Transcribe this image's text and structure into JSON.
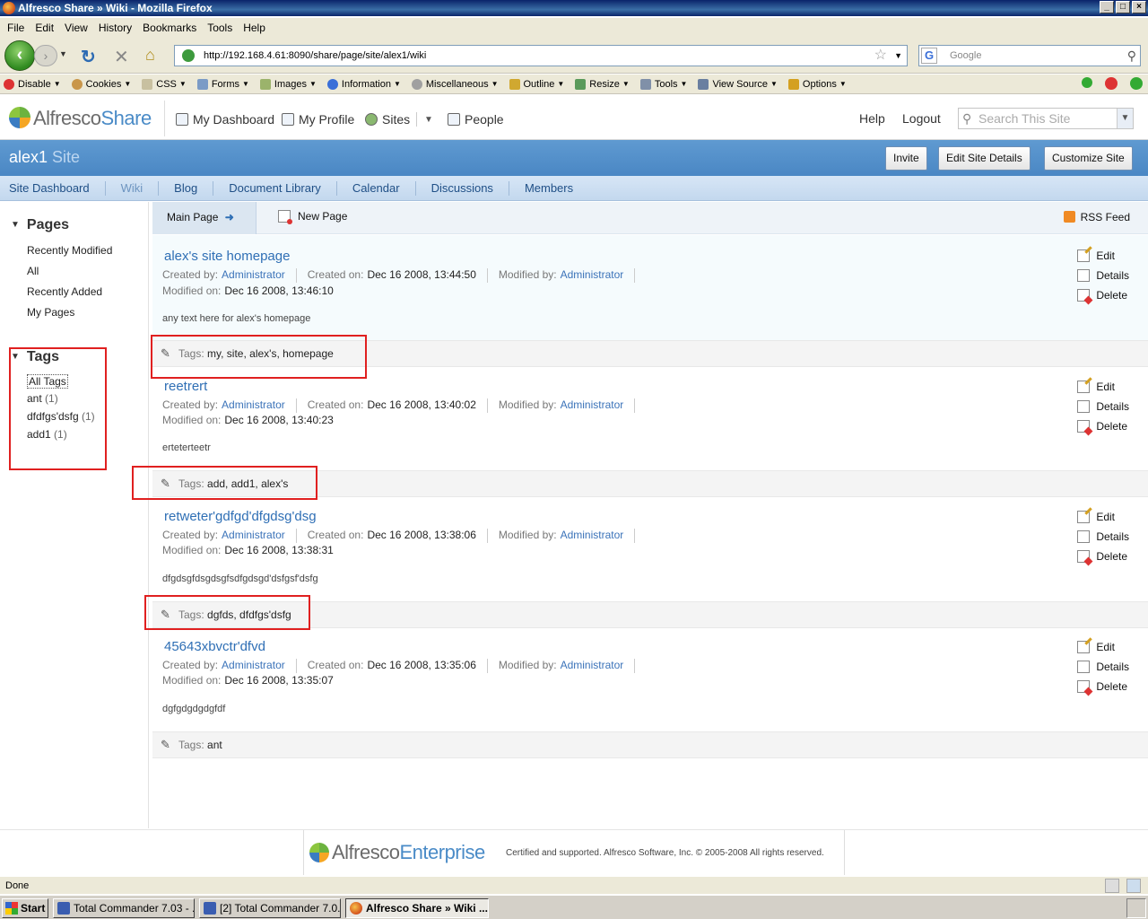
{
  "window": {
    "title": "Alfresco Share » Wiki - Mozilla Firefox"
  },
  "menubar": [
    "File",
    "Edit",
    "View",
    "History",
    "Bookmarks",
    "Tools",
    "Help"
  ],
  "browser": {
    "url": "http://192.168.4.61:8090/share/page/site/alex1/wiki",
    "search_placeholder": "Google"
  },
  "devtoolbar": [
    "Disable",
    "Cookies",
    "CSS",
    "Forms",
    "Images",
    "Information",
    "Miscellaneous",
    "Outline",
    "Resize",
    "Tools",
    "View Source",
    "Options"
  ],
  "header": {
    "logo_prefix": "Alfresco",
    "logo_suffix": "Share",
    "nav": [
      "My Dashboard",
      "My Profile",
      "Sites",
      "People"
    ],
    "help": "Help",
    "logout": "Logout",
    "search_placeholder": "Search This Site"
  },
  "site": {
    "name": "alex1",
    "label": "Site",
    "buttons": [
      "Invite",
      "Edit Site Details",
      "Customize Site"
    ],
    "nav": [
      "Site Dashboard",
      "Wiki",
      "Blog",
      "Document Library",
      "Calendar",
      "Discussions",
      "Members"
    ]
  },
  "left": {
    "pages_heading": "Pages",
    "pages": [
      "Recently Modified",
      "All",
      "Recently Added",
      "My Pages"
    ],
    "tags_heading": "Tags",
    "all_tags": "All Tags",
    "tags": [
      {
        "name": "ant",
        "count": "(1)"
      },
      {
        "name": "dfdfgs'dsfg",
        "count": "(1)"
      },
      {
        "name": "add1",
        "count": "(1)"
      }
    ]
  },
  "toolbar": {
    "main_page": "Main Page",
    "new_page": "New Page",
    "rss": "RSS Feed"
  },
  "labels": {
    "created_by": "Created by:",
    "created_on": "Created on:",
    "modified_by": "Modified by:",
    "modified_on": "Modified on:",
    "tags": "Tags:",
    "edit": "Edit",
    "details": "Details",
    "delete": "Delete"
  },
  "pages": [
    {
      "title": "alex's site homepage",
      "created_by": "Administrator",
      "created_on": "Dec 16 2008, 13:44:50",
      "modified_by": "Administrator",
      "modified_on": "Dec 16 2008, 13:46:10",
      "text": "any text here for alex's homepage",
      "tags": "my, site, alex's, homepage"
    },
    {
      "title": "reetrert",
      "created_by": "Administrator",
      "created_on": "Dec 16 2008, 13:40:02",
      "modified_by": "Administrator",
      "modified_on": "Dec 16 2008, 13:40:23",
      "text": "erteterteetr",
      "tags": "add, add1, alex's"
    },
    {
      "title": "retweter'gdfgd'dfgdsg'dsg",
      "created_by": "Administrator",
      "created_on": "Dec 16 2008, 13:38:06",
      "modified_by": "Administrator",
      "modified_on": "Dec 16 2008, 13:38:31",
      "text": "dfgdsgfdsgdsgfsdfgdsgd'dsfgsf'dsfg",
      "tags": "dgfds, dfdfgs'dsfg"
    },
    {
      "title": "45643xbvctr'dfvd",
      "created_by": "Administrator",
      "created_on": "Dec 16 2008, 13:35:06",
      "modified_by": "Administrator",
      "modified_on": "Dec 16 2008, 13:35:07",
      "text": "dgfgdgdgdgfdf",
      "tags": "ant"
    }
  ],
  "footer": {
    "logo_prefix": "Alfresco",
    "logo_suffix": "Enterprise",
    "text": "Certified and supported. Alfresco Software, Inc. © 2005-2008 All rights reserved."
  },
  "status": {
    "text": "Done"
  },
  "taskbar": {
    "start": "Start",
    "tasks": [
      "Total Commander 7.03 - ...",
      "[2] Total Commander 7.0...",
      "Alfresco Share » Wiki ..."
    ]
  }
}
